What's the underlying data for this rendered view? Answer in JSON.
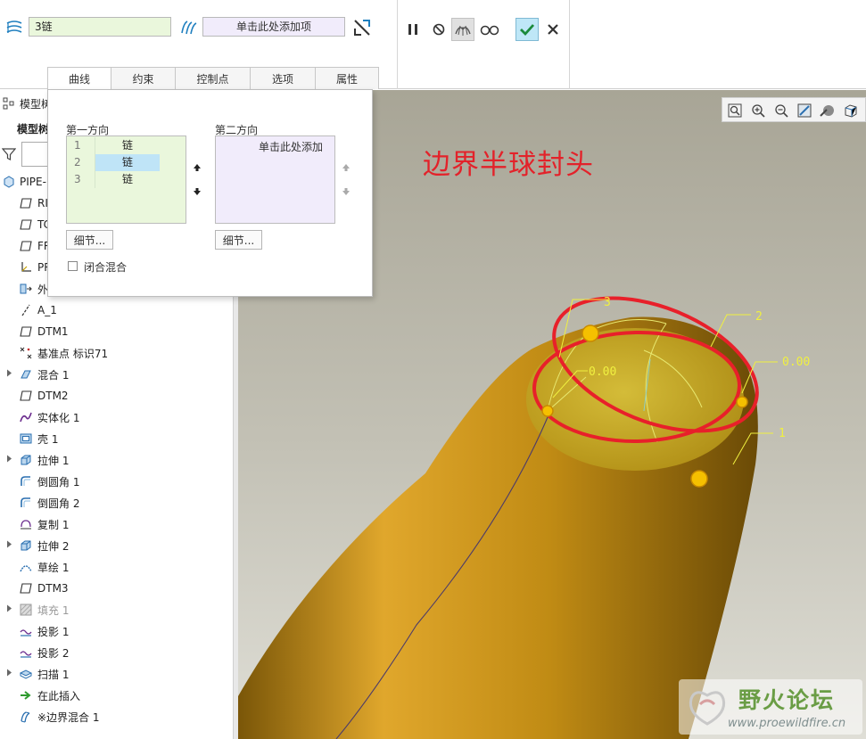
{
  "dashboard": {
    "first_field_value": "3链",
    "second_field_value": "单击此处添加项",
    "icons": [
      "boundary-blend-icon",
      "surface-icon",
      "swap-direction-icon",
      "pause-icon",
      "no-preview-icon",
      "verify-icon",
      "glasses-icon",
      "ok-check-icon",
      "cancel-icon"
    ],
    "accent": "#1f8bc4"
  },
  "tabs": [
    {
      "label": "曲线"
    },
    {
      "label": "约束"
    },
    {
      "label": "控制点"
    },
    {
      "label": "选项"
    },
    {
      "label": "属性"
    }
  ],
  "panel": {
    "first_direction_title": "第一方向",
    "second_direction_title": "第二方向",
    "first_list": [
      {
        "num": "1",
        "value": "链"
      },
      {
        "num": "2",
        "value": "链"
      },
      {
        "num": "3",
        "value": "链"
      }
    ],
    "second_list_placeholder": "单击此处添加",
    "details_button_1": "细节...",
    "details_button_2": "细节...",
    "closed_blend_label": "闭合混合"
  },
  "tree": {
    "header": "模型树",
    "header_sub": "模型树",
    "root": "PIPE-",
    "items": [
      {
        "label": "RI",
        "icon": "datum-plane-icon",
        "expandable": false,
        "disabled": false
      },
      {
        "label": "TC",
        "icon": "datum-plane-icon",
        "expandable": false,
        "disabled": false
      },
      {
        "label": "FR",
        "icon": "datum-plane-icon",
        "expandable": false,
        "disabled": false
      },
      {
        "label": "PR",
        "icon": "coordinate-system-icon",
        "expandable": false,
        "disabled": false
      },
      {
        "label": "外",
        "icon": "external-copy-icon",
        "expandable": false,
        "disabled": false
      },
      {
        "label": "A_1",
        "icon": "datum-axis-icon",
        "expandable": false,
        "disabled": false
      },
      {
        "label": "DTM1",
        "icon": "datum-plane-icon",
        "expandable": false,
        "disabled": false
      },
      {
        "label": "基准点 标识71",
        "icon": "datum-point-icon",
        "expandable": false,
        "disabled": false
      },
      {
        "label": "混合 1",
        "icon": "blend-icon",
        "expandable": true,
        "disabled": false
      },
      {
        "label": "DTM2",
        "icon": "datum-plane-icon",
        "expandable": false,
        "disabled": false
      },
      {
        "label": "实体化 1",
        "icon": "solidify-icon",
        "expandable": false,
        "disabled": false
      },
      {
        "label": "壳 1",
        "icon": "shell-icon",
        "expandable": false,
        "disabled": false
      },
      {
        "label": "拉伸 1",
        "icon": "extrude-icon",
        "expandable": true,
        "disabled": false
      },
      {
        "label": "倒圆角 1",
        "icon": "round-icon",
        "expandable": false,
        "disabled": false
      },
      {
        "label": "倒圆角 2",
        "icon": "round-icon",
        "expandable": false,
        "disabled": false
      },
      {
        "label": "复制 1",
        "icon": "copy-icon",
        "expandable": false,
        "disabled": false
      },
      {
        "label": "拉伸 2",
        "icon": "extrude-icon",
        "expandable": true,
        "disabled": false
      },
      {
        "label": "草绘 1",
        "icon": "sketch-icon",
        "expandable": false,
        "disabled": false
      },
      {
        "label": "DTM3",
        "icon": "datum-plane-icon",
        "expandable": false,
        "disabled": false
      },
      {
        "label": "填充 1",
        "icon": "fill-icon",
        "expandable": true,
        "disabled": true
      },
      {
        "label": "投影 1",
        "icon": "project-icon",
        "expandable": false,
        "disabled": false
      },
      {
        "label": "投影 2",
        "icon": "project-icon",
        "expandable": false,
        "disabled": false
      },
      {
        "label": "扫描 1",
        "icon": "sweep-icon",
        "expandable": true,
        "disabled": false
      },
      {
        "label": "在此插入",
        "icon": "insert-here-arrow-icon",
        "expandable": false,
        "disabled": false
      },
      {
        "label": "※边界混合 1",
        "icon": "boundary-blend-icon",
        "expandable": false,
        "disabled": false
      }
    ]
  },
  "viewport": {
    "annotation": "边界半球封头",
    "dim_labels": [
      "3",
      "2",
      "0.00",
      "0.00",
      "1"
    ],
    "view_tools": [
      "refit-icon",
      "zoom-in-icon",
      "zoom-out-icon",
      "repaint-icon",
      "display-style-icon",
      "saved-views-icon"
    ],
    "model_color": "#c8960f",
    "curve_color": "#e8202a"
  },
  "watermark": {
    "title": "野火论坛",
    "url": "www.proewildfire.cn"
  }
}
